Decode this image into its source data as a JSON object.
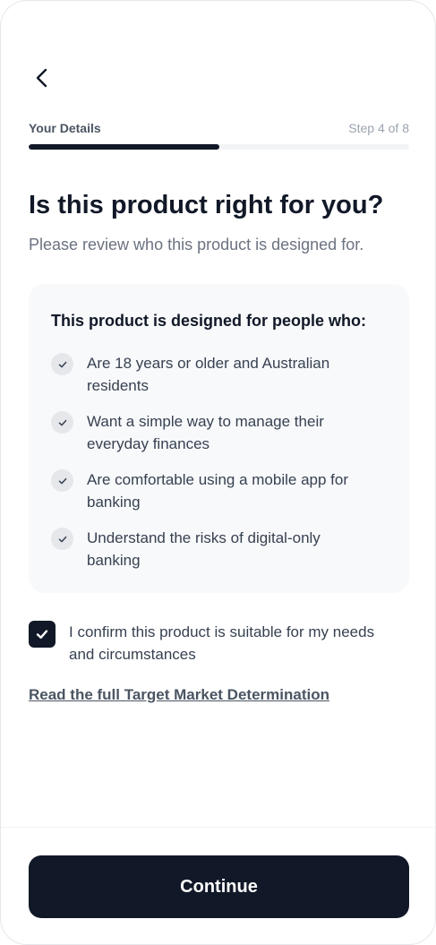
{
  "header": {
    "back_icon": "chevron-left-icon"
  },
  "progress": {
    "label": "Your Details",
    "step_text": "Step 4 of 8",
    "fraction": 0.5,
    "track_color": "#f3f4f6",
    "fill_color": "#111827"
  },
  "main": {
    "title": "Is this product right for you?",
    "subtitle": "Please review who this product is designed for."
  },
  "criteria_card": {
    "heading": "This product is designed for people who:",
    "check_icon": "check-icon",
    "items": [
      {
        "text": "Are 18 years or older and Australian residents"
      },
      {
        "text": "Want a simple way to manage their everyday finances"
      },
      {
        "text": "Are comfortable using a mobile app for banking"
      },
      {
        "text": "Understand the risks of digital-only banking"
      }
    ]
  },
  "confirmation": {
    "checked": true,
    "label": "I confirm this product is suitable for my needs and circumstances"
  },
  "link": {
    "label": "Read the full Target Market Determination"
  },
  "footer": {
    "continue_label": "Continue"
  },
  "colors": {
    "primary": "#111827",
    "muted_text": "#6b7280",
    "card_background": "#f8f9fb"
  }
}
